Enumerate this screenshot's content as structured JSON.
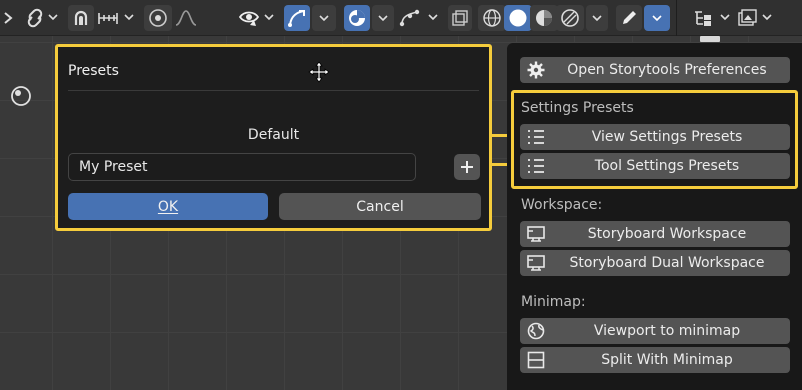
{
  "header": {
    "tools": [
      {
        "name": "transform-pivot-icon"
      },
      {
        "name": "proportional-editing-icon"
      },
      {
        "name": "snap-icon"
      },
      {
        "name": "snap-increment-icon"
      },
      {
        "name": "falloff-icon"
      },
      {
        "name": "visibility-eye-icon"
      },
      {
        "name": "gizmo-icon"
      },
      {
        "name": "overlays-icon"
      },
      {
        "name": "xray-icon"
      },
      {
        "name": "wireframe-shading-icon"
      },
      {
        "name": "solid-shading-icon"
      },
      {
        "name": "material-shading-icon"
      },
      {
        "name": "rendered-shading-icon"
      },
      {
        "name": "pencil-icon"
      },
      {
        "name": "outliner-icon"
      },
      {
        "name": "image-icon"
      }
    ]
  },
  "presets_popup": {
    "title": "Presets",
    "default_label": "Default",
    "name_value": "My Preset",
    "add_icon": "plus-icon",
    "ok_label": "OK",
    "cancel_label": "Cancel"
  },
  "menu": {
    "open_prefs": "Open Storytools Preferences",
    "settings_presets_label": "Settings Presets",
    "view_presets": "View Settings Presets",
    "tool_presets": "Tool Settings Presets",
    "workspace_label": "Workspace:",
    "storyboard_ws": "Storyboard Workspace",
    "storyboard_dual_ws": "Storyboard Dual Workspace",
    "minimap_label": "Minimap:",
    "viewport_minimap": "Viewport to minimap",
    "split_minimap": "Split With Minimap"
  },
  "colors": {
    "accent": "#4772b3",
    "highlight": "#f5cc3c",
    "button": "#545454",
    "panel": "#181818"
  }
}
